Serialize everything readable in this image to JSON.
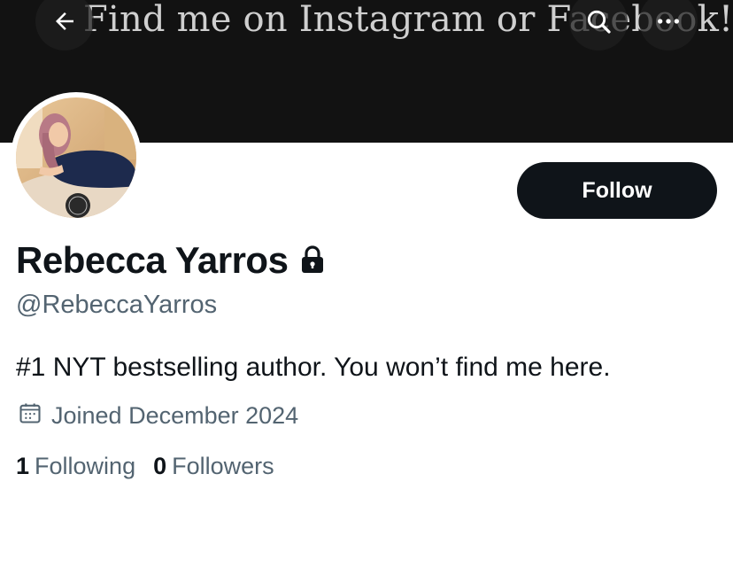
{
  "banner": {
    "text": "Find me on Instagram or Facebook!"
  },
  "nav": {
    "back_icon": "arrow-left-icon",
    "search_icon": "search-icon",
    "more_icon": "more-horizontal-icon"
  },
  "profile": {
    "display_name": "Rebecca Yarros",
    "handle": "@RebeccaYarros",
    "bio": "#1 NYT bestselling author. You won’t find me here.",
    "joined": "Joined December 2024",
    "protected_icon": "lock-icon",
    "calendar_icon": "calendar-icon"
  },
  "actions": {
    "follow_label": "Follow"
  },
  "stats": {
    "following_count": "1",
    "following_label": "Following",
    "followers_count": "0",
    "followers_label": "Followers"
  },
  "colors": {
    "text_primary": "#0f1419",
    "text_secondary": "#536471",
    "banner_bg": "#121212",
    "button_bg": "#0f1419"
  }
}
